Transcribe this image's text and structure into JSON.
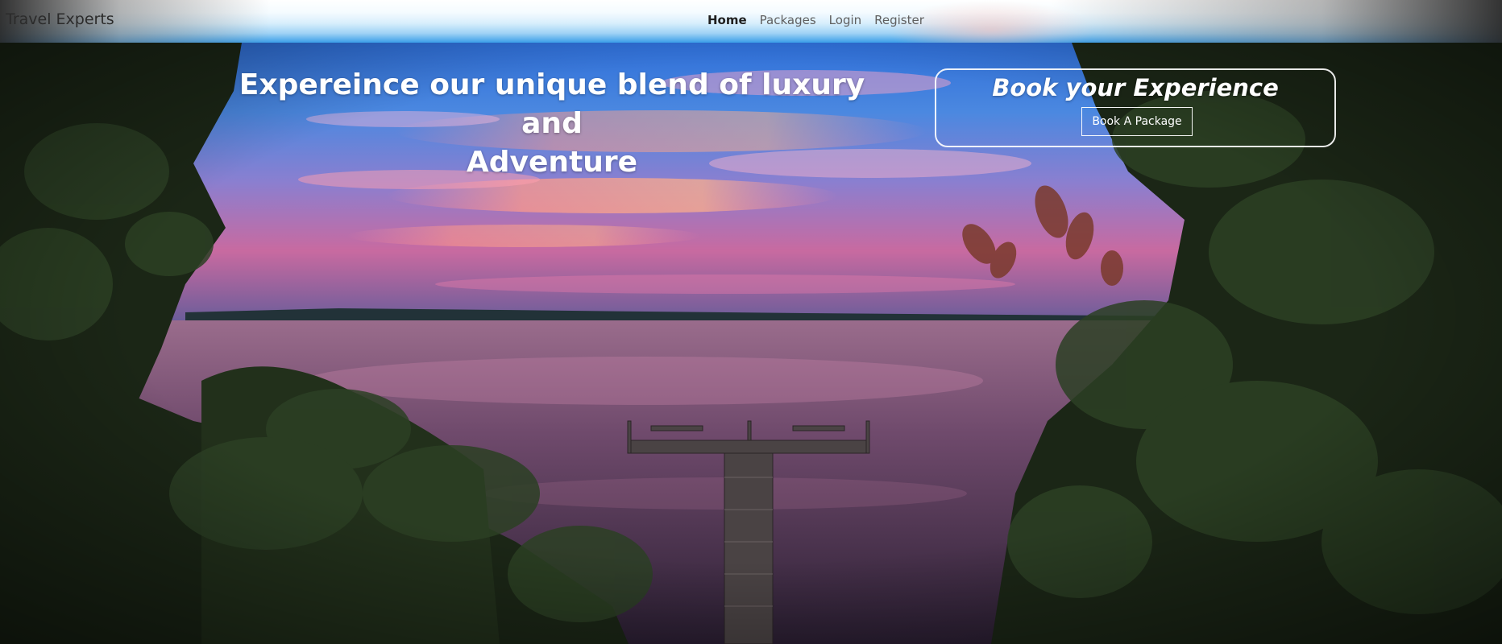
{
  "navbar": {
    "brand": "Travel Experts",
    "links": [
      {
        "label": "Home",
        "active": true
      },
      {
        "label": "Packages",
        "active": false
      },
      {
        "label": "Login",
        "active": false
      },
      {
        "label": "Register",
        "active": false
      }
    ]
  },
  "hero": {
    "headline_line1": "Expereince our unique blend of luxury and",
    "headline_line2": "Adventure",
    "book_title": "Book your Experience",
    "book_button": "Book A Package",
    "background_scene": "lake-sunset-dock-photo"
  },
  "colors": {
    "sky_top": "#3f78d8",
    "sky_pink": "#f08aa6",
    "water": "#5b3a63",
    "foliage": "#1d2a1a",
    "text": "#ffffff"
  }
}
